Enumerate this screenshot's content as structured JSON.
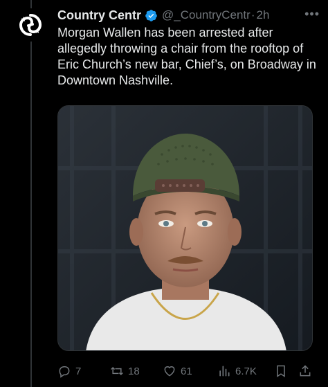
{
  "account": {
    "display_name": "Country Centr",
    "handle": "@_CountryCentr",
    "separator": "·",
    "time": "2h",
    "verified": true,
    "avatar_icon": "country-central-logo-icon"
  },
  "tweet": {
    "text": "Morgan Wallen has been arrested after allegedly throwing a chair from the rooftop of Eric Church’s new bar, Chief’s, on Broadway in Downtown Nashville."
  },
  "media": {
    "kind": "photo",
    "subject": "man in green cap with white t-shirt and gold chain"
  },
  "actions": {
    "reply_count": "7",
    "retweet_count": "18",
    "like_count": "61",
    "views_count": "6.7K"
  },
  "colors": {
    "background": "#000000",
    "text": "#e7e9ea",
    "muted": "#71767b",
    "verified": "#1d9bf0"
  }
}
